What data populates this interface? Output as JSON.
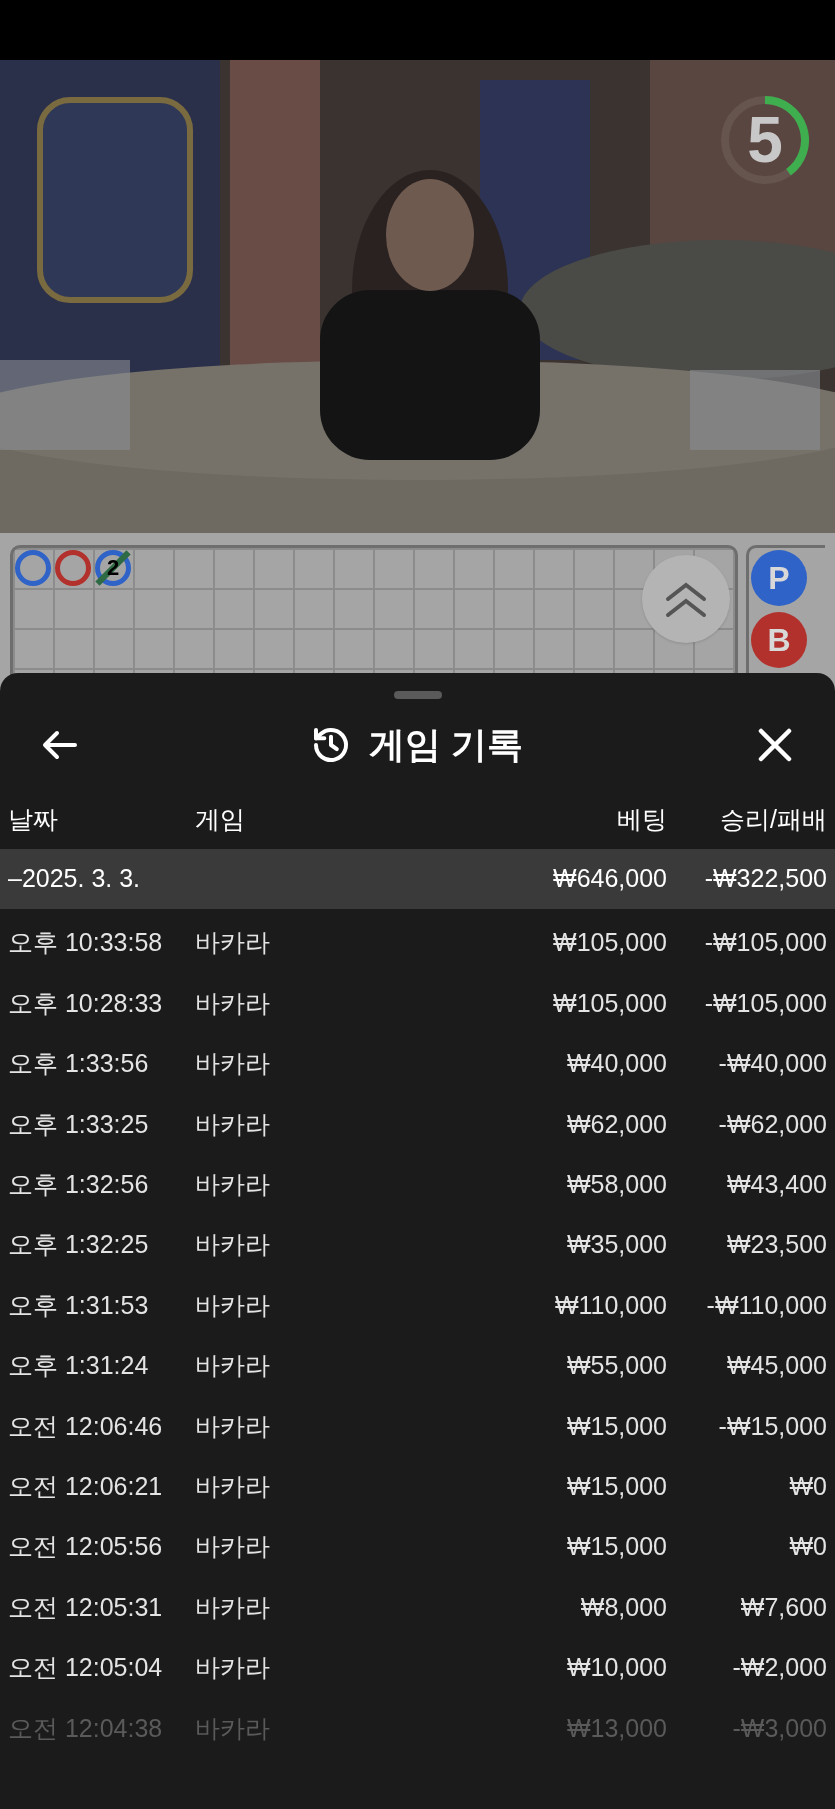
{
  "video": {
    "countdown": {
      "value": "5",
      "level": 0.4
    }
  },
  "road": {
    "marks": [
      {
        "kind": "ring",
        "color": "#2f63c8"
      },
      {
        "kind": "ring",
        "color": "#b3312c"
      },
      {
        "kind": "tie",
        "color": "#2f63c8",
        "label": "2"
      }
    ],
    "side_buttons": [
      {
        "label": "P",
        "color": "#2f63c8"
      },
      {
        "label": "B",
        "color": "#b3312c"
      }
    ]
  },
  "sheet": {
    "title": "게임 기록",
    "columns": [
      "날짜",
      "게임",
      "베팅",
      "승리/패배"
    ],
    "rows": [
      {
        "kind": "summary",
        "date": "–2025. 3. 3.",
        "bet": "₩646,000",
        "result": "-₩322,500"
      },
      {
        "kind": "game",
        "date": "오후 10:33:58",
        "game": "바카라",
        "bet": "₩105,000",
        "result": "-₩105,000"
      },
      {
        "kind": "game",
        "date": "오후 10:28:33",
        "game": "바카라",
        "bet": "₩105,000",
        "result": "-₩105,000"
      },
      {
        "kind": "game",
        "date": "오후 1:33:56",
        "game": "바카라",
        "bet": "₩40,000",
        "result": "-₩40,000"
      },
      {
        "kind": "game",
        "date": "오후 1:33:25",
        "game": "바카라",
        "bet": "₩62,000",
        "result": "-₩62,000"
      },
      {
        "kind": "game",
        "date": "오후 1:32:56",
        "game": "바카라",
        "bet": "₩58,000",
        "result": "₩43,400"
      },
      {
        "kind": "game",
        "date": "오후 1:32:25",
        "game": "바카라",
        "bet": "₩35,000",
        "result": "₩23,500"
      },
      {
        "kind": "game",
        "date": "오후 1:31:53",
        "game": "바카라",
        "bet": "₩110,000",
        "result": "-₩110,000"
      },
      {
        "kind": "game",
        "date": "오후 1:31:24",
        "game": "바카라",
        "bet": "₩55,000",
        "result": "₩45,000"
      },
      {
        "kind": "game",
        "date": "오전 12:06:46",
        "game": "바카라",
        "bet": "₩15,000",
        "result": "-₩15,000"
      },
      {
        "kind": "game",
        "date": "오전 12:06:21",
        "game": "바카라",
        "bet": "₩15,000",
        "result": "₩0"
      },
      {
        "kind": "game",
        "date": "오전 12:05:56",
        "game": "바카라",
        "bet": "₩15,000",
        "result": "₩0"
      },
      {
        "kind": "game",
        "date": "오전 12:05:31",
        "game": "바카라",
        "bet": "₩8,000",
        "result": "₩7,600"
      },
      {
        "kind": "game",
        "date": "오전 12:05:04",
        "game": "바카라",
        "bet": "₩10,000",
        "result": "-₩2,000"
      },
      {
        "kind": "faded",
        "date": "오전 12:04:38",
        "game": "바카라",
        "bet": "₩13,000",
        "result": "-₩3,000"
      }
    ]
  }
}
